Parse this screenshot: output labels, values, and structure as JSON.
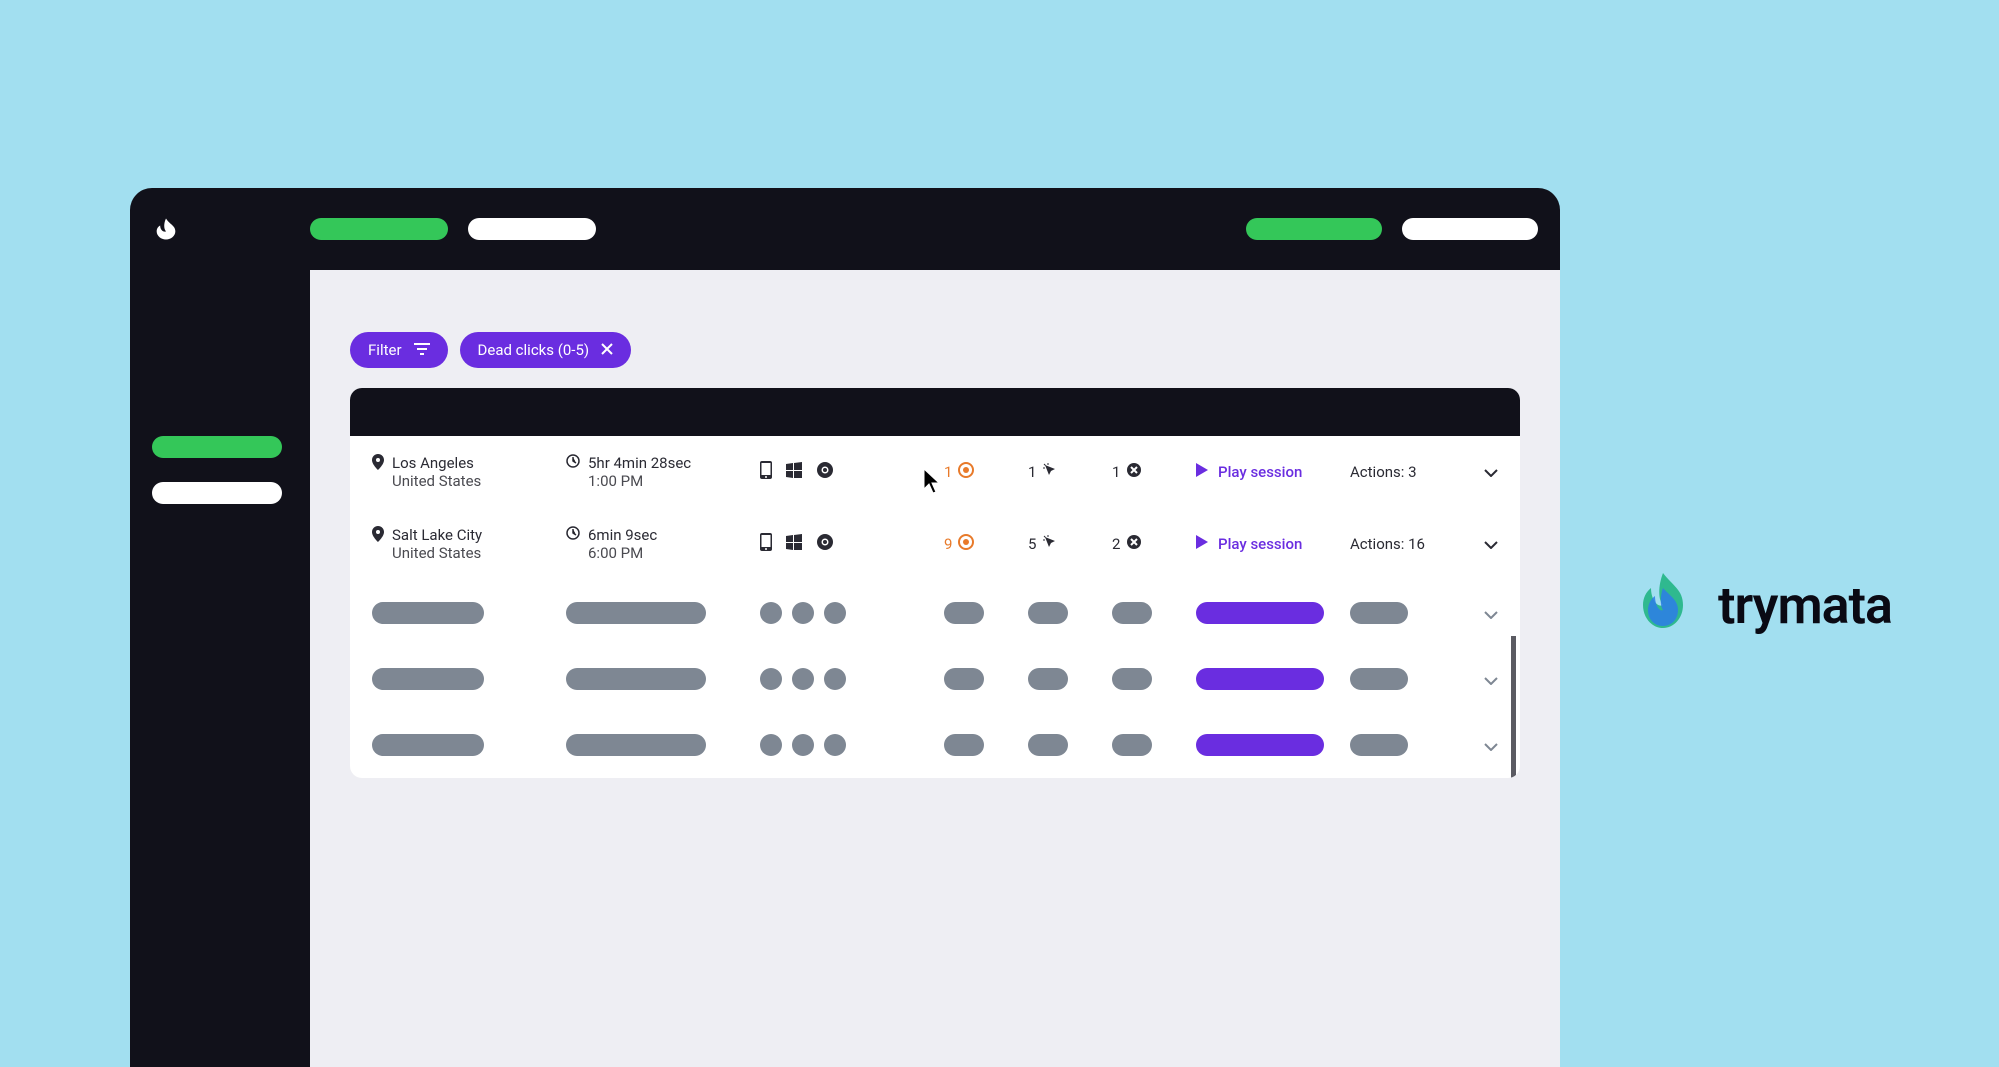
{
  "filters": {
    "filter_label": "Filter",
    "active_filter": "Dead clicks (0-5)"
  },
  "sessions": [
    {
      "city": "Los Angeles",
      "country": "United States",
      "duration": "5hr 4min 28sec",
      "time": "1:00 PM",
      "rage": "1",
      "dead": "1",
      "error": "1",
      "play": "Play session",
      "actions_label": "Actions: 3"
    },
    {
      "city": "Salt Lake City",
      "country": "United States",
      "duration": "6min 9sec",
      "time": "6:00 PM",
      "rage": "9",
      "dead": "5",
      "error": "2",
      "play": "Play session",
      "actions_label": "Actions: 16"
    }
  ],
  "brand": "trymata"
}
